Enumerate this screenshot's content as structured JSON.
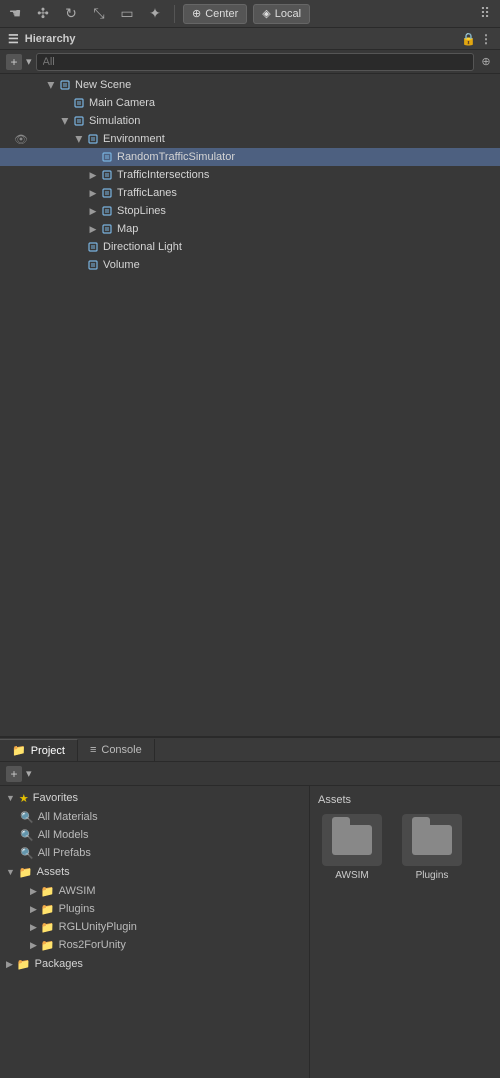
{
  "toolbar": {
    "icons": [
      "hand",
      "move",
      "rotate",
      "scale",
      "rect",
      "transform"
    ],
    "center_label": "Center",
    "local_label": "Local",
    "grid_icon": "grid"
  },
  "hierarchy": {
    "panel_title": "Hierarchy",
    "search_placeholder": "All",
    "tree": [
      {
        "id": "new-scene",
        "label": "New Scene",
        "depth": 0,
        "has_arrow": true,
        "arrow_open": true,
        "has_cube": true
      },
      {
        "id": "main-camera",
        "label": "Main Camera",
        "depth": 1,
        "has_arrow": false,
        "has_cube": true
      },
      {
        "id": "simulation",
        "label": "Simulation",
        "depth": 1,
        "has_arrow": true,
        "arrow_open": true,
        "has_cube": true
      },
      {
        "id": "environment",
        "label": "Environment",
        "depth": 2,
        "has_arrow": true,
        "arrow_open": true,
        "has_cube": true
      },
      {
        "id": "random-traffic",
        "label": "RandomTrafficSimulator",
        "depth": 3,
        "has_arrow": false,
        "has_cube": true,
        "hovered": true
      },
      {
        "id": "traffic-intersections",
        "label": "TrafficIntersections",
        "depth": 3,
        "has_arrow": true,
        "arrow_open": false,
        "has_cube": true
      },
      {
        "id": "traffic-lanes",
        "label": "TrafficLanes",
        "depth": 3,
        "has_arrow": true,
        "arrow_open": false,
        "has_cube": true
      },
      {
        "id": "stop-lines",
        "label": "StopLines",
        "depth": 3,
        "has_arrow": true,
        "arrow_open": false,
        "has_cube": true
      },
      {
        "id": "map",
        "label": "Map",
        "depth": 3,
        "has_arrow": true,
        "arrow_open": false,
        "has_cube": true
      },
      {
        "id": "directional-light",
        "label": "Directional Light",
        "depth": 2,
        "has_arrow": false,
        "has_cube": true
      },
      {
        "id": "volume",
        "label": "Volume",
        "depth": 2,
        "has_arrow": false,
        "has_cube": true
      }
    ]
  },
  "project": {
    "tab_label": "Project",
    "console_tab_label": "Console",
    "assets_title": "Assets",
    "favorites_label": "Favorites",
    "all_materials_label": "All Materials",
    "all_models_label": "All Models",
    "all_prefabs_label": "All Prefabs",
    "assets_label": "Assets",
    "folders": [
      {
        "label": "AWSIM"
      },
      {
        "label": "Plugins"
      },
      {
        "label": "RGLUnityPlugin"
      },
      {
        "label": "Ros2ForUnity"
      }
    ],
    "packages_label": "Packages",
    "asset_items": [
      {
        "label": "AWSIM"
      },
      {
        "label": "Plugins"
      }
    ]
  },
  "colors": {
    "bg_dark": "#2a2a2a",
    "bg_mid": "#383838",
    "bg_light": "#3c3c3c",
    "accent_blue": "#2c5282",
    "hover": "#4d6080",
    "folder_color": "#c8a050",
    "star_color": "#e5c000"
  }
}
